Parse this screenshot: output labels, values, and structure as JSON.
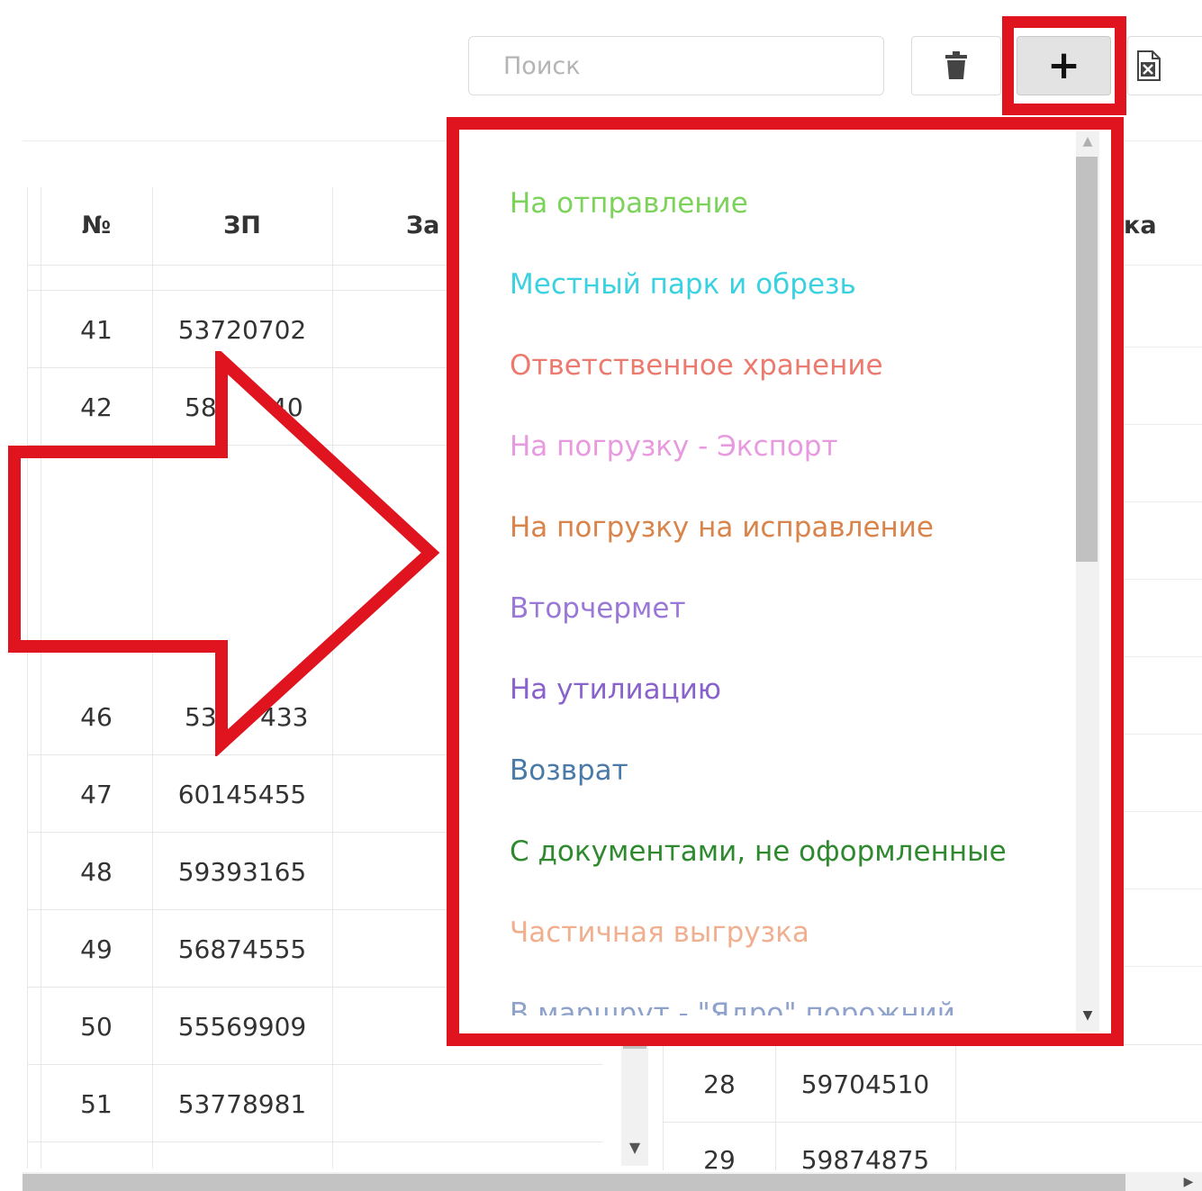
{
  "toolbar": {
    "search_placeholder": "Поиск",
    "delete_icon": "trash-icon",
    "add_label": "+",
    "export_icon": "excel-file-icon"
  },
  "left_table": {
    "headers": [
      "№",
      "ЗП",
      "За"
    ],
    "rows": [
      {
        "num": "41",
        "zp": "53720702"
      },
      {
        "num": "42",
        "zp": "58"
      },
      {
        "num": "46",
        "zp": "53"
      },
      {
        "num": "47",
        "zp": "60145455"
      },
      {
        "num": "48",
        "zp": "59393165"
      },
      {
        "num": "49",
        "zp": "56874555"
      },
      {
        "num": "50",
        "zp": "55569909"
      },
      {
        "num": "51",
        "zp": "53778981"
      }
    ],
    "partial_fragments": [
      "40",
      "433"
    ]
  },
  "right_table": {
    "header_fragment": "ка",
    "rows": [
      {
        "num": "28",
        "zp": "59704510"
      },
      {
        "num": "29",
        "zp": "59874875"
      }
    ]
  },
  "dropdown": {
    "items": [
      {
        "label": "На отправление",
        "color": "#7cd35a"
      },
      {
        "label": "Местный парк и обрезь",
        "color": "#3ad2e0"
      },
      {
        "label": "Ответственное хранение",
        "color": "#ec7a6e"
      },
      {
        "label": "На погрузку - Экспорт",
        "color": "#e89ae0"
      },
      {
        "label": "На погрузку на исправление",
        "color": "#d9844a"
      },
      {
        "label": "Вторчермет",
        "color": "#9a78d8"
      },
      {
        "label": "На утилиацию",
        "color": "#8a62cc"
      },
      {
        "label": "Возврат",
        "color": "#4a7aa8"
      },
      {
        "label": "С документами, не оформленные",
        "color": "#2f8a2f"
      },
      {
        "label": "Частичная выгрузка",
        "color": "#f0b090"
      },
      {
        "label": "В маршрут - \"Ядро\" порожний",
        "color": "#8ea2cc"
      }
    ]
  },
  "annotation": {
    "highlight_color": "#e0141e"
  }
}
